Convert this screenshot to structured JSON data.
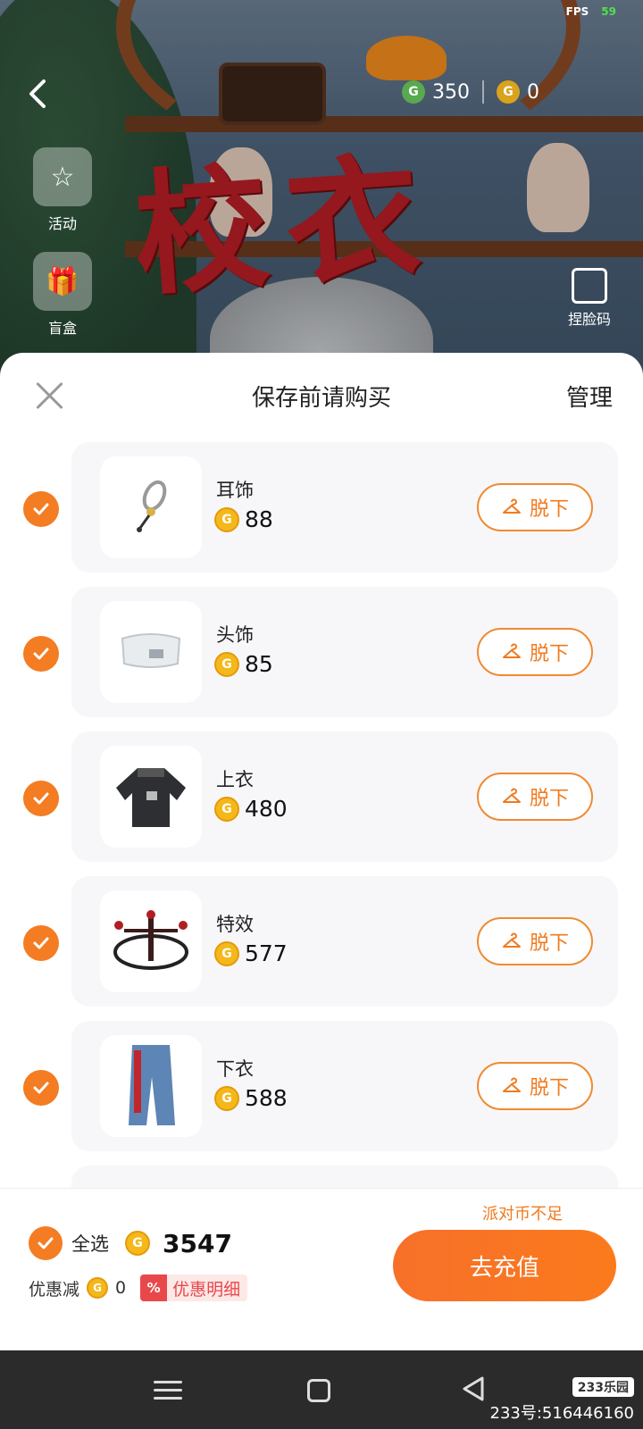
{
  "status": {
    "fps_label": "FPS",
    "fps_value": "59"
  },
  "scene": {
    "art_text": "校衣",
    "side_menu": [
      {
        "label": "活动",
        "icon": "star-icon"
      },
      {
        "label": "盲盒",
        "icon": "gift-box-icon"
      }
    ],
    "party_coins": "350",
    "gold_coins": "0",
    "face_code_label": "捏脸码"
  },
  "sheet": {
    "title": "保存前请购买",
    "manage_label": "管理",
    "takeoff_label": "脱下",
    "items": [
      {
        "name": "耳饰",
        "price": "88",
        "icon": "earring-icon"
      },
      {
        "name": "头饰",
        "price": "85",
        "icon": "headband-icon"
      },
      {
        "name": "上衣",
        "price": "480",
        "icon": "sweater-icon"
      },
      {
        "name": "特效",
        "price": "577",
        "icon": "effect-icon"
      },
      {
        "name": "下衣",
        "price": "588",
        "icon": "jeans-icon"
      }
    ],
    "footer": {
      "insufficient_text": "派对币不足",
      "select_all_label": "全选",
      "total": "3547",
      "discount_label": "优惠减",
      "discount_value": "0",
      "promo_tag": "%",
      "promo_label": "优惠明细",
      "recharge_label": "去充值"
    }
  },
  "watermark": {
    "logo": "233乐园",
    "text": "233号:516446160"
  },
  "colors": {
    "accent": "#f47c22",
    "coin": "#f5b81a",
    "promo_red": "#e8484a"
  }
}
